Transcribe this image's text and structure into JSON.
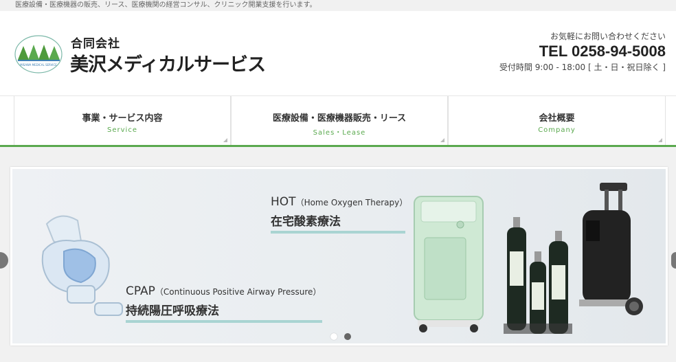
{
  "topbar": {
    "text": "医療設備・医療機器の販売、リース、医療機関の経営コンサル、クリニック開業支援を行います。"
  },
  "logo": {
    "company_small": "合同会社",
    "company_big": "美沢メディカルサービス",
    "mark_caption": "MISAWA MEDICAL SERVICE"
  },
  "contact": {
    "lead": "お気軽にお問い合わせください",
    "tel": "TEL 0258-94-5008",
    "hours": "受付時間 9:00 - 18:00 [ 土・日・祝日除く ]"
  },
  "nav": [
    {
      "jp": "事業・サービス内容",
      "en": "Service"
    },
    {
      "jp": "医療設備・医療機器販売・リース",
      "en": "Sales・Lease"
    },
    {
      "jp": "会社概要",
      "en": "Company"
    }
  ],
  "slider": {
    "hot": {
      "en_main": "HOT",
      "en_sub": "（Home Oxygen Therapy）",
      "jp": "在宅酸素療法"
    },
    "cpap": {
      "en_main": "CPAP",
      "en_sub": "（Continuous Positive Airway Pressure）",
      "jp": "持続陽圧呼吸療法"
    },
    "dots_total": 2,
    "active_dot": 2
  },
  "colors": {
    "accent": "#5aa94e",
    "caption_line": "#a9d4d2"
  },
  "icons": {
    "prev": "chevron-left-icon",
    "next": "chevron-right-icon"
  }
}
